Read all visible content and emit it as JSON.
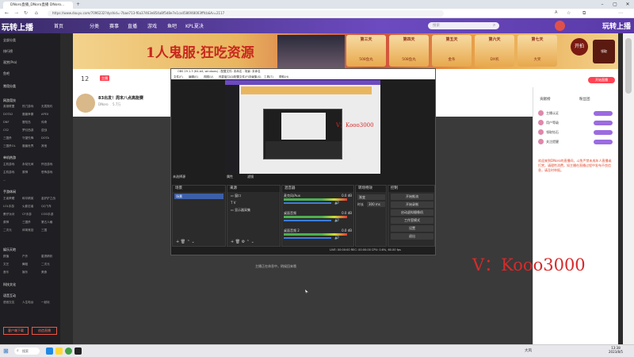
{
  "browser": {
    "tabs": [
      {
        "label": "DNoro直播_DNoro直播 DNoro..."
      }
    ],
    "url": "https://www.douyu.com/7096232?dyshid=-7bae713-f6a37463e854a8f5d8e7e1ca4586f48003fffcb&fv=2117",
    "zoom": "A"
  },
  "nav": {
    "brand": "玩转上播",
    "items": [
      "首页",
      "分类",
      "赛事",
      "直播",
      "游戏",
      "鱼吧",
      "KPL夏决"
    ],
    "search_placeholder": "搜索",
    "open_btn": "开播",
    "open_btn2": "开始直播"
  },
  "banner": {
    "title": "1人鬼服·狂吃资源",
    "days": [
      "第三天",
      "第四天",
      "第五天",
      "第六天",
      "第七天"
    ],
    "prizes": [
      "508鱼丸",
      "508鱼丸",
      "金条",
      "DX机",
      "大奖"
    ],
    "cta": "开拍",
    "cta_sub": "领取"
  },
  "sidebar": {
    "top": [
      "全部分类",
      "排行榜",
      "观赏(Pro)",
      "鱼吧"
    ],
    "sections": [
      {
        "title": "常用分类"
      },
      {
        "title": "网游竞技",
        "rows": [
          [
            "英雄联盟",
            "热门游戏",
            "无畏契约"
          ],
          [
            "DOTA2",
            "魔兽争霸",
            "APEX"
          ],
          [
            "DNF",
            "冒险岛",
            "传奇"
          ],
          [
            "CS2",
            "梦幻西游",
            "逆战"
          ],
          [
            "三国杀",
            "守望先锋",
            "DOTA"
          ],
          [
            "三国杀OL",
            "魔兽世界",
            "其他"
          ]
        ]
      },
      {
        "title": "单机热游",
        "rows": [
          [
            "主机游戏",
            "永劫无间",
            "怀旧游戏"
          ],
          [
            "主机游戏",
            "原神",
            "恐怖游戏"
          ],
          [
            "...",
            "",
            ""
          ]
        ]
      },
      {
        "title": "手游休闲",
        "rows": [
          [
            "王者荣耀",
            "和平精英",
            "金铲铲之战"
          ],
          [
            "LOL手游",
            "火影忍者",
            "QQ飞车"
          ],
          [
            "蛋仔派对",
            "CF手游",
            "COD手游"
          ],
          [
            "原神",
            "三国杀",
            "第五人格"
          ],
          [
            "二次元",
            "体育竞技",
            "三国"
          ]
        ]
      },
      {
        "title": "娱乐天地",
        "rows": [
          [
            "颜值",
            "户外",
            "星秀精彩"
          ],
          [
            "文艺",
            "舞蹈",
            "二次元"
          ],
          [
            "音乐",
            "娱乐",
            "美食"
          ]
        ]
      },
      {
        "title": "科技文化"
      },
      {
        "title": "语音互动",
        "rows": [
          [
            "语音交友",
            "人生电台",
            "一起玩"
          ]
        ]
      }
    ],
    "footer_btns": [
      "客户端下载",
      "创造直播"
    ]
  },
  "room": {
    "level": "12",
    "streamer_tag": "主播",
    "title": "83出发！周末八点高能赛",
    "followers": "5.7万",
    "name": "DNoro"
  },
  "obs": {
    "title": "OBS 29.1.3 (64-bit, windows) - 配置文件: 未命名 - 场景: 未命名",
    "menu": [
      "文件(F)",
      "编辑(E)",
      "视图(V)",
      "停靠窗口(D)",
      "配置文件(P)",
      "场景集(S)",
      "工具(T)",
      "帮助(H)"
    ],
    "preview_label": "未选择源",
    "tabs": [
      "属性",
      "滤镜"
    ],
    "scenes_header": "场景",
    "scene_items": [
      "场景"
    ],
    "sources_header": "来源",
    "source_items": [
      "窗口",
      "V",
      "显示器采集"
    ],
    "mixer_header": "混音器",
    "mixer": [
      {
        "name": "麦克风/Aux",
        "db": "0.0 dB"
      },
      {
        "name": "桌面音频",
        "db": "0.0 dB"
      },
      {
        "name": "桌面音频 2",
        "db": "0.0 dB"
      }
    ],
    "transitions_header": "转场特效",
    "transition_value": "渐变",
    "duration_label": "时长",
    "duration_value": "300 ms",
    "controls_header": "控制",
    "controls": [
      "开始推流",
      "开始录制",
      "启动虚拟摄像机",
      "工作室模式",
      "设置",
      "退出"
    ],
    "status": "LIVE: 00:00:00    REC: 00:00:00    CPU: 0.6%, 60.00 fps"
  },
  "player_msg": [
    "主播正在休息中，稍候回来哦"
  ],
  "watermarks": [
    "V：Kooo3000",
    "V：Kooo3000"
  ],
  "right_panel": {
    "tabs": [
      "贡献榜",
      "粉丝团"
    ],
    "rows": [
      "主播认证",
      "用户等级",
      "领取钻石",
      "关注提醒"
    ],
    "chat": "欢迎来到DNoro的直播间，斗鱼严禁未成年人直播或打赏，请理性消费，如主播在直播过程中发布不良信息，请及时举报。"
  },
  "taskbar": {
    "search": "搜索",
    "weather": "大风",
    "time": "13:38",
    "date": "2023/8/5"
  }
}
